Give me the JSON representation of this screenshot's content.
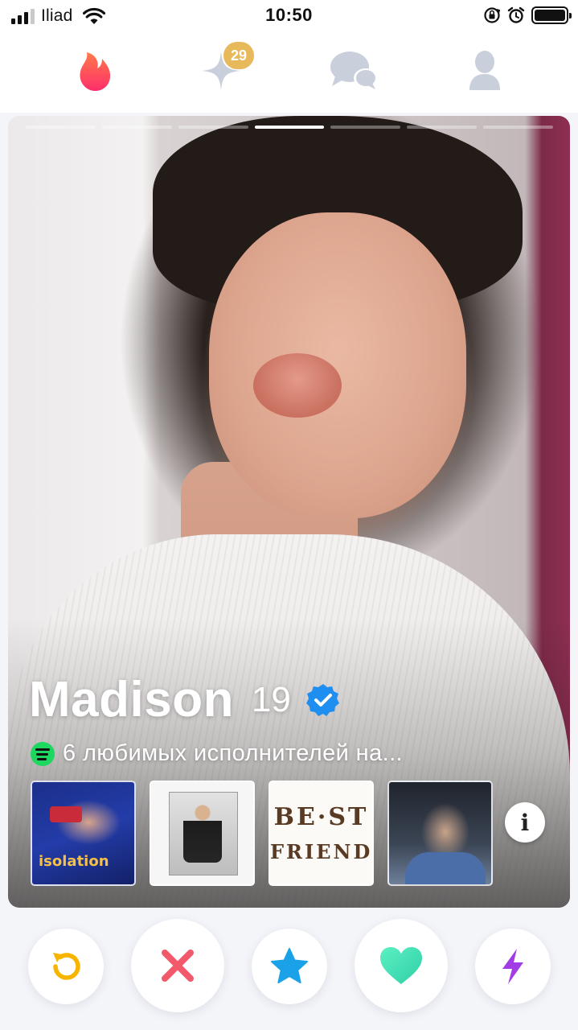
{
  "status_bar": {
    "carrier": "Iliad",
    "time": "10:50",
    "icons": [
      "signal-icon",
      "wifi-icon",
      "orientation-lock-icon",
      "alarm-icon",
      "battery-icon"
    ]
  },
  "top_nav": {
    "items": [
      {
        "id": "swipe",
        "icon": "flame-icon",
        "active": true,
        "color": "#fd3b5c"
      },
      {
        "id": "explore",
        "icon": "sparkle-icon",
        "badge": "29",
        "badge_color": "#e8b95a"
      },
      {
        "id": "messages",
        "icon": "chat-bubbles-icon"
      },
      {
        "id": "profile",
        "icon": "user-icon"
      }
    ]
  },
  "card": {
    "photo_count": 7,
    "active_photo": 4,
    "name": "Madison",
    "age": "19",
    "verified": true,
    "spotify": {
      "text": "6 любимых исполнителей на..."
    },
    "artists": [
      {
        "cover_text": "isolation"
      },
      {
        "cover_text": ""
      },
      {
        "cover_text_line1": "BE·ST",
        "cover_text_line2": "FRIEND"
      },
      {
        "cover_text": ""
      }
    ],
    "info_label": "i"
  },
  "actions": [
    {
      "id": "rewind",
      "icon": "rewind-icon",
      "color": "#f7b500"
    },
    {
      "id": "nope",
      "icon": "close-icon",
      "color": "#f25a6b"
    },
    {
      "id": "super-like",
      "icon": "star-icon",
      "color": "#1aa1e8"
    },
    {
      "id": "like",
      "icon": "heart-icon",
      "color": "#4ee0b3"
    },
    {
      "id": "boost",
      "icon": "lightning-icon",
      "color": "#a23de6"
    }
  ]
}
